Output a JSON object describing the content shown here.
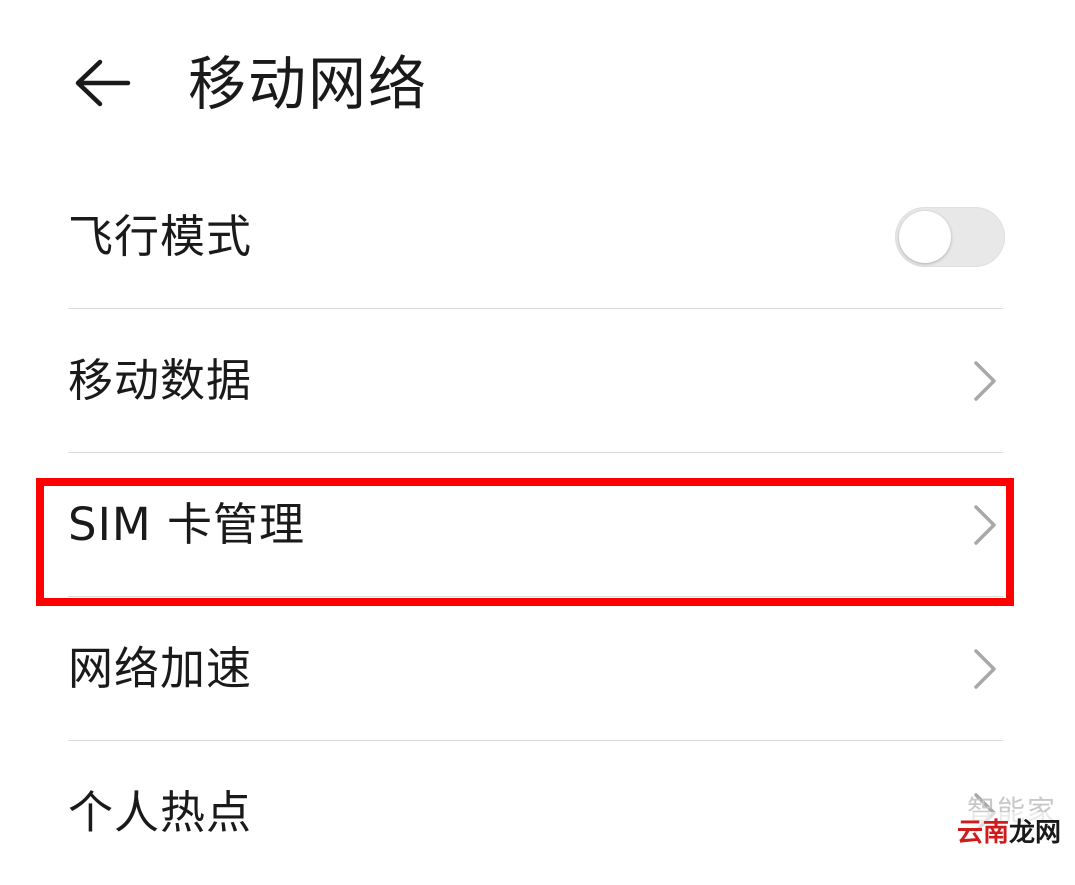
{
  "header": {
    "title": "移动网络",
    "back_icon": "arrow-left-icon"
  },
  "rows": [
    {
      "label": "飞行模式",
      "control": "toggle",
      "toggle_state": "off"
    },
    {
      "label": "移动数据",
      "control": "chevron"
    },
    {
      "label": "SIM 卡管理",
      "control": "chevron",
      "highlighted": true
    },
    {
      "label": "网络加速",
      "control": "chevron"
    },
    {
      "label": "个人热点",
      "control": "chevron"
    }
  ],
  "highlight_color": "#ff0000",
  "watermark": {
    "top_text": "智能家",
    "main_text_red": "云南",
    "main_text_dark": "龙网"
  }
}
